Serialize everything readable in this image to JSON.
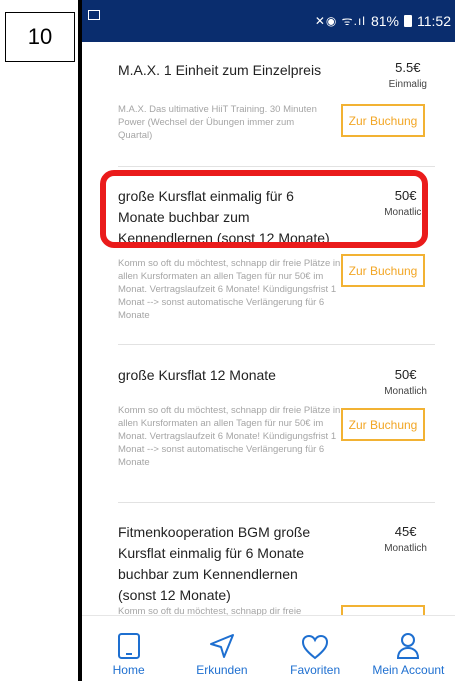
{
  "step_label": "10",
  "status_bar": {
    "signal_icons": "✕◉ ᯤ.ıl",
    "battery": "81%",
    "time": "11:52"
  },
  "items": [
    {
      "title": "M.A.X. 1 Einheit zum Einzelpreis",
      "price": "5.5€",
      "unit": "Einmalig",
      "description": "M.A.X. Das ultimative HiiT Training. 30 Minuten Power (Wechsel der Übungen immer zum Quartal)",
      "button": "Zur Buchung"
    },
    {
      "title": "große Kursflat einmalig für 6 Monate buchbar zum Kennendlernen (sonst 12 Monate)",
      "price": "50€",
      "unit": "Monatlich",
      "description": "Komm so oft du möchtest, schnapp dir freie Plätze in allen Kursformaten an allen Tagen für nur 50€ im Monat. Vertragslaufzeit 6 Monate! Kündigungsfrist 1 Monat --> sonst automatische Verlängerung für 6 Monate",
      "button": "Zur Buchung"
    },
    {
      "title": "große Kursflat 12 Monate",
      "price": "50€",
      "unit": "Monatlich",
      "description": "Komm so oft du möchtest, schnapp dir freie Plätze in allen Kursformaten an allen Tagen für nur 50€ im Monat. Vertragslaufzeit 6 Monate! Kündigungsfrist 1 Monat --> sonst automatische Verlängerung für 6 Monate",
      "button": "Zur Buchung"
    },
    {
      "title": "Fitmenkooperation BGM große Kursflat einmalig für 6 Monate buchbar zum Kennendlernen (sonst 12 Monate)",
      "price": "45€",
      "unit": "Monatlich",
      "description": "Komm so oft du möchtest, schnapp dir freie",
      "button": ""
    }
  ],
  "tabs": [
    {
      "label": "Home",
      "icon": "tablet-icon"
    },
    {
      "label": "Erkunden",
      "icon": "navigation-arrow-icon"
    },
    {
      "label": "Favoriten",
      "icon": "heart-icon"
    },
    {
      "label": "Mein Account",
      "icon": "person-icon"
    }
  ],
  "colors": {
    "status_bar": "#0a2d6e",
    "accent": "#f2a624",
    "highlight": "#ea1b1b",
    "tab": "#1e6fd0"
  }
}
